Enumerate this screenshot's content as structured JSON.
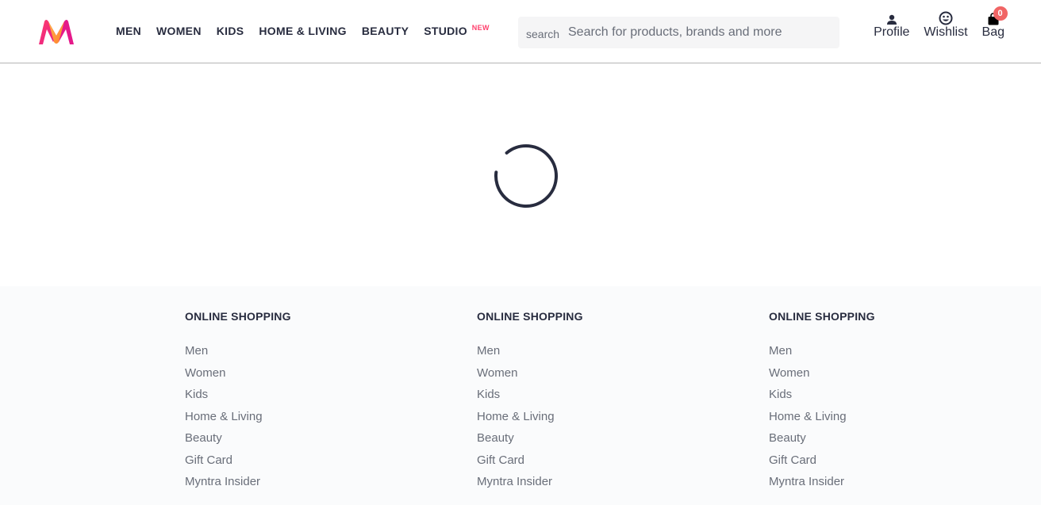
{
  "header": {
    "logo_name": "myntra-logo",
    "nav": [
      {
        "label": "MEN",
        "badge": ""
      },
      {
        "label": "WOMEN",
        "badge": ""
      },
      {
        "label": "KIDS",
        "badge": ""
      },
      {
        "label": "HOME & LIVING",
        "badge": ""
      },
      {
        "label": "BEAUTY",
        "badge": ""
      },
      {
        "label": "STUDIO",
        "badge": "NEW"
      }
    ],
    "search": {
      "icon_text": "search",
      "placeholder": "Search for products, brands and more",
      "value": ""
    },
    "actions": {
      "profile": "Profile",
      "wishlist": "Wishlist",
      "bag": "Bag",
      "bag_count": "0"
    }
  },
  "loader": {
    "state": "loading"
  },
  "footer": {
    "columns": [
      {
        "title": "ONLINE SHOPPING",
        "links": [
          "Men",
          "Women",
          "Kids",
          "Home & Living",
          "Beauty",
          "Gift Card",
          "Myntra Insider"
        ]
      },
      {
        "title": "ONLINE SHOPPING",
        "links": [
          "Men",
          "Women",
          "Kids",
          "Home & Living",
          "Beauty",
          "Gift Card",
          "Myntra Insider"
        ]
      },
      {
        "title": "ONLINE SHOPPING",
        "links": [
          "Men",
          "Women",
          "Kids",
          "Home & Living",
          "Beauty",
          "Gift Card",
          "Myntra Insider"
        ]
      }
    ]
  },
  "colors": {
    "accent": "#ff3f6c",
    "badge": "#f16565",
    "text": "#282c3f",
    "muted": "#696e79",
    "footer_bg": "#fafbfc"
  }
}
